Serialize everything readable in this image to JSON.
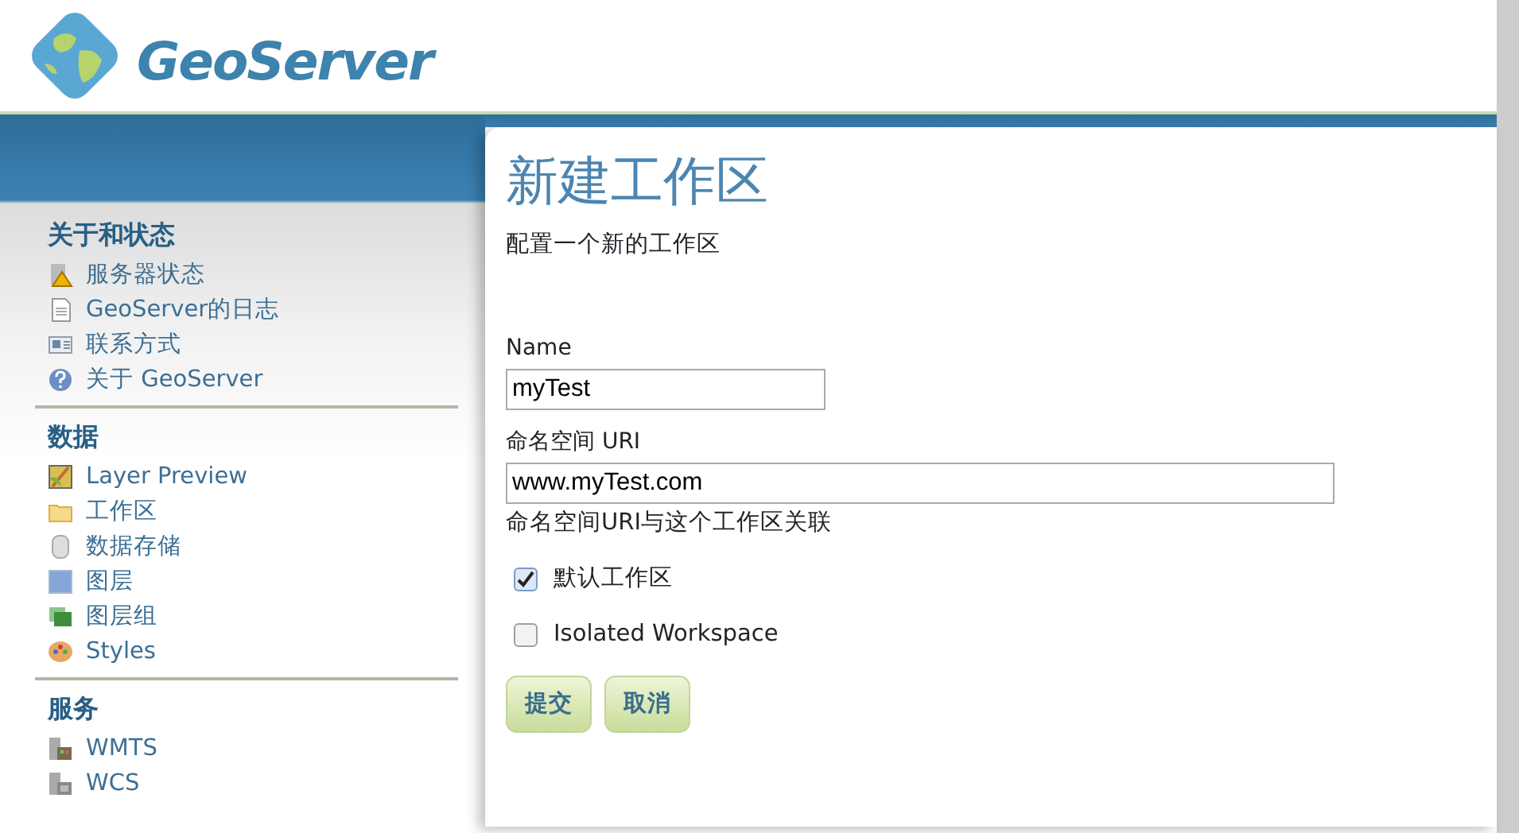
{
  "header": {
    "logo_text": "GeoServer"
  },
  "sidebar": {
    "sections": [
      {
        "title": "关于和状态",
        "items": [
          {
            "label": "服务器状态"
          },
          {
            "label": "GeoServer的日志"
          },
          {
            "label": "联系方式"
          },
          {
            "label": "关于 GeoServer"
          }
        ]
      },
      {
        "title": "数据",
        "items": [
          {
            "label": "Layer Preview"
          },
          {
            "label": "工作区"
          },
          {
            "label": "数据存储"
          },
          {
            "label": "图层"
          },
          {
            "label": "图层组"
          },
          {
            "label": "Styles"
          }
        ]
      },
      {
        "title": "服务",
        "items": [
          {
            "label": "WMTS"
          },
          {
            "label": "WCS"
          }
        ]
      }
    ]
  },
  "page": {
    "title": "新建工作区",
    "subtitle": "配置一个新的工作区",
    "fields": [
      {
        "label": "Name",
        "value": "myTest"
      },
      {
        "label": "命名空间 URI",
        "value": "www.myTest.com",
        "hint": "命名空间URI与这个工作区关联"
      }
    ],
    "checkboxes": [
      {
        "label": "默认工作区",
        "checked": true
      },
      {
        "label": "Isolated Workspace",
        "checked": false
      }
    ],
    "buttons": [
      "提交",
      "取消"
    ]
  }
}
